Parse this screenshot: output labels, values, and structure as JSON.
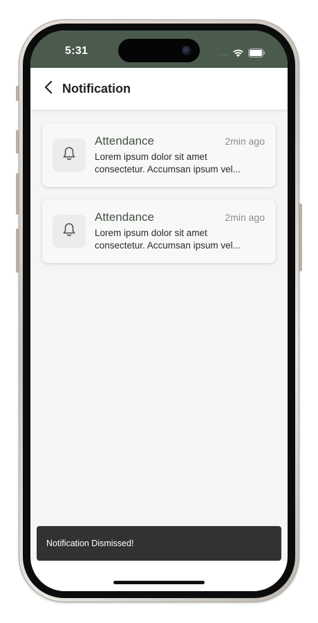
{
  "status_bar": {
    "time": "5:31",
    "signal_icon": "signal-dots-icon",
    "wifi_icon": "wifi-icon",
    "battery_icon": "battery-icon",
    "signal_text": "....",
    "color": "#4a5a4d"
  },
  "header": {
    "back_icon": "chevron-left-icon",
    "title": "Notification"
  },
  "notifications": [
    {
      "icon": "bell-icon",
      "title": "Attendance",
      "time": "2min ago",
      "body_line1": "Lorem ipsum dolor sit amet",
      "body_line2": "consectetur. Accumsan ipsum vel..."
    },
    {
      "icon": "bell-icon",
      "title": "Attendance",
      "time": "2min ago",
      "body_line1": "Lorem ipsum dolor sit amet",
      "body_line2": "consectetur. Accumsan ipsum vel..."
    }
  ],
  "snackbar": {
    "message": "Notification Dismissed!"
  },
  "colors": {
    "accent": "#445244",
    "background": "#f5f5f5",
    "snackbar": "#323232"
  }
}
